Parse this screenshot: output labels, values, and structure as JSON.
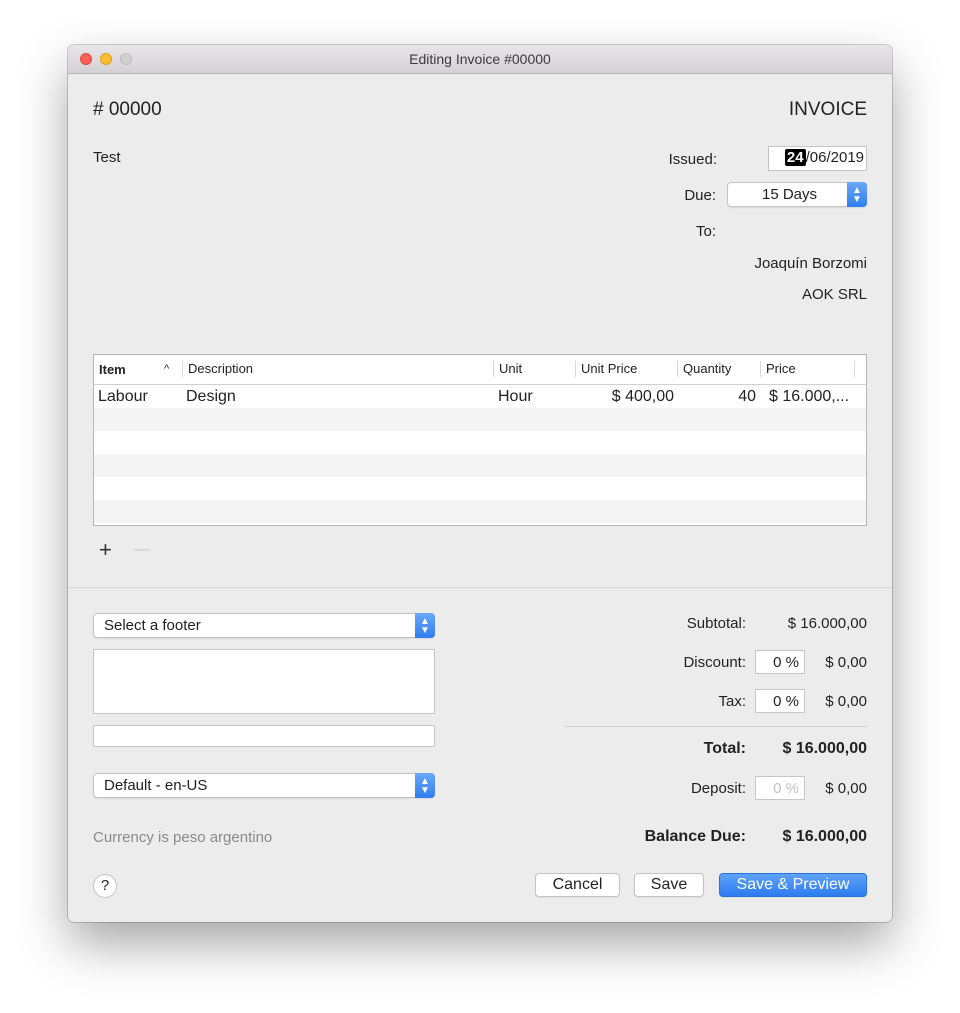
{
  "window": {
    "title": "Editing Invoice #00000"
  },
  "header": {
    "invoice_number": "# 00000",
    "doc_type": "INVOICE",
    "subject": "Test"
  },
  "meta": {
    "issued_label": "Issued:",
    "issued_day": "24",
    "issued_rest": "/06/2019",
    "due_label": "Due:",
    "due_value": "15 Days",
    "to_label": "To:",
    "client_name": "Joaquín Borzomi",
    "client_company": "AOK SRL"
  },
  "table": {
    "headers": {
      "item": "Item",
      "sort_indicator": "^",
      "description": "Description",
      "unit": "Unit",
      "unit_price": "Unit Price",
      "quantity": "Quantity",
      "price": "Price"
    },
    "rows": [
      {
        "item": "Labour",
        "description": "Design",
        "unit": "Hour",
        "unit_price": "$ 400,00",
        "quantity": "40",
        "price": "$ 16.000,..."
      }
    ],
    "add_symbol": "+",
    "remove_symbol": "—"
  },
  "footer": {
    "footer_select": "Select a footer",
    "locale_select": "Default - en-US",
    "currency_note": "Currency is peso argentino"
  },
  "totals": {
    "subtotal_label": "Subtotal:",
    "subtotal_value": "$ 16.000,00",
    "discount_label": "Discount:",
    "discount_pct": "0 %",
    "discount_value": "$ 0,00",
    "tax_label": "Tax:",
    "tax_pct": "0 %",
    "tax_value": "$ 0,00",
    "total_label": "Total:",
    "total_value": "$ 16.000,00",
    "deposit_label": "Deposit:",
    "deposit_pct": "0 %",
    "deposit_value": "$ 0,00",
    "balance_label": "Balance Due:",
    "balance_value": "$ 16.000,00"
  },
  "buttons": {
    "help": "?",
    "cancel": "Cancel",
    "save": "Save",
    "save_preview": "Save & Preview"
  }
}
